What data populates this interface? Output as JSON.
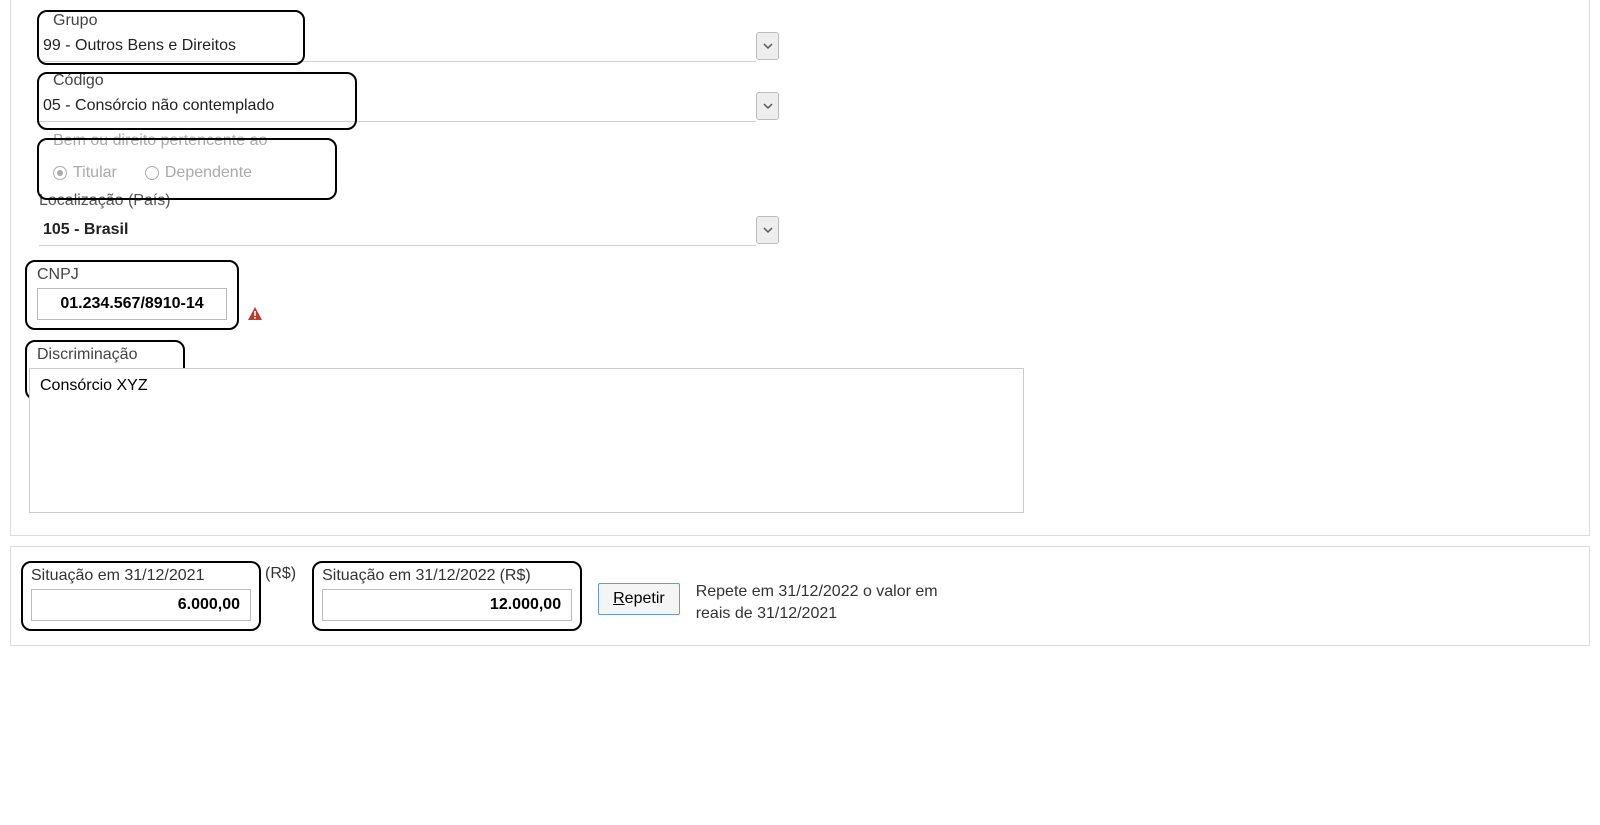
{
  "grupo": {
    "label": "Grupo",
    "value": "99 - Outros Bens e Direitos"
  },
  "codigo": {
    "label": "Código",
    "value": "05 - Consórcio não contemplado"
  },
  "pertencente": {
    "label": "Bem ou direito pertencente ao",
    "option_titular": "Titular",
    "option_dependente": "Dependente"
  },
  "localizacao": {
    "label": "Localização (País)",
    "value": "105 - Brasil"
  },
  "cnpj": {
    "label": "CNPJ",
    "value": "01.234.567/8910-14"
  },
  "discriminacao": {
    "label": "Discriminação",
    "value": "Consórcio XYZ"
  },
  "situacao_2021": {
    "label": "Situação em 31/12/2021",
    "suffix": "(R$)",
    "value": "6.000,00"
  },
  "situacao_2022": {
    "label": "Situação em 31/12/2022",
    "suffix": "(R$)",
    "value": "12.000,00"
  },
  "repetir": {
    "label_first": "R",
    "label_rest": "epetir",
    "hint": "Repete em 31/12/2022 o valor em reais de 31/12/2021"
  }
}
